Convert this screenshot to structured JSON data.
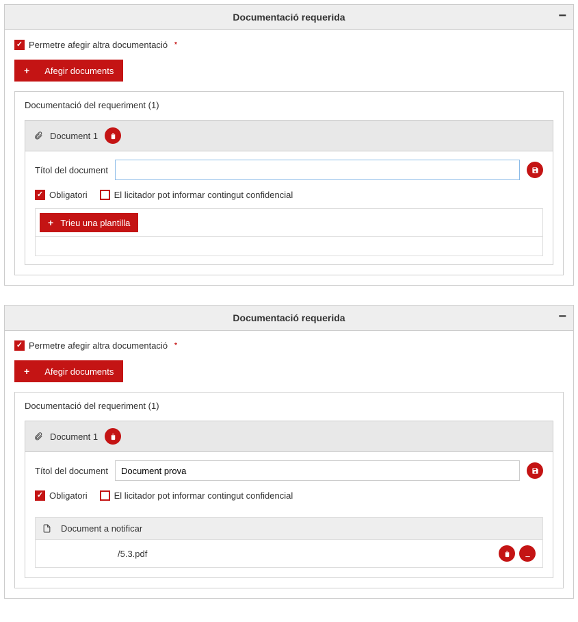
{
  "panels": [
    {
      "header": "Documentació requerida",
      "allow_other_label": "Permetre afegir altra documentació",
      "allow_other_checked": true,
      "add_docs_btn": "Afegir documents",
      "req_docs_label": "Documentació del requeriment (1)",
      "doc": {
        "name": "Document 1",
        "title_label": "Títol del document",
        "title_value": "",
        "mandatory_label": "Obligatori",
        "mandatory_checked": true,
        "confidential_label": "El licitador pot informar contingut confidencial",
        "confidential_checked": false,
        "choose_template_btn": "Trieu una plantilla"
      }
    },
    {
      "header": "Documentació requerida",
      "allow_other_label": "Permetre afegir altra documentació",
      "allow_other_checked": true,
      "add_docs_btn": "Afegir documents",
      "req_docs_label": "Documentació del requeriment (1)",
      "doc": {
        "name": "Document 1",
        "title_label": "Títol del document",
        "title_value": "Document prova",
        "mandatory_label": "Obligatori",
        "mandatory_checked": true,
        "confidential_label": "El licitador pot informar contingut confidencial",
        "confidential_checked": false,
        "notify_header": "Document a notificar",
        "filename": "/5.3.pdf"
      }
    }
  ]
}
